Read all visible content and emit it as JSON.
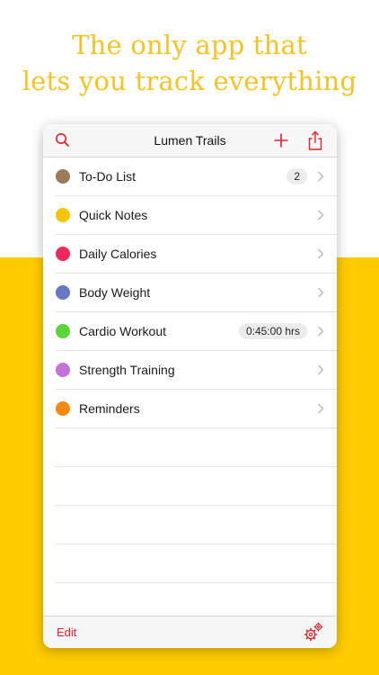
{
  "headline": {
    "line1": "The only app that",
    "line2": "lets you track everything"
  },
  "colors": {
    "yellow": "#ffcc00",
    "headline": "#f4c325",
    "accent_red": "#e0202c"
  },
  "navbar": {
    "title": "Lumen Trails",
    "search_icon": "search-icon",
    "add_icon": "plus-icon",
    "share_icon": "share-icon"
  },
  "trackers": [
    {
      "label": "To-Do List",
      "color": "#9b7b58",
      "badge": "2"
    },
    {
      "label": "Quick Notes",
      "color": "#f6c500",
      "badge": ""
    },
    {
      "label": "Daily Calories",
      "color": "#ee2a5d",
      "badge": ""
    },
    {
      "label": "Body Weight",
      "color": "#6478c3",
      "badge": ""
    },
    {
      "label": "Cardio Workout",
      "color": "#5cd23c",
      "badge": "0:45:00 hrs"
    },
    {
      "label": "Strength Training",
      "color": "#c572d8",
      "badge": ""
    },
    {
      "label": "Reminders",
      "color": "#f28a12",
      "badge": ""
    }
  ],
  "toolbar": {
    "edit_label": "Edit",
    "settings_icon": "gears-icon"
  }
}
